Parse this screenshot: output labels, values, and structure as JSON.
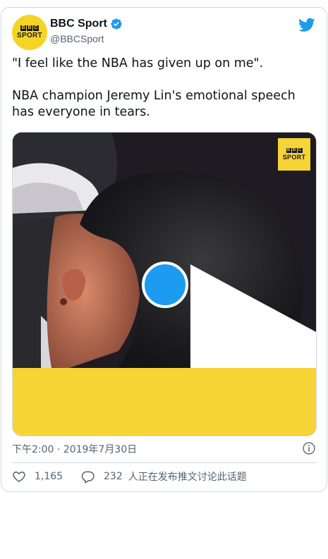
{
  "account": {
    "avatar_bbc_letters": [
      "B",
      "B",
      "C"
    ],
    "avatar_sport_text": "SPORT",
    "display_name": "BBC Sport",
    "handle": "@BBCSport",
    "verified_icon": "verified-badge-icon",
    "brand_icon": "twitter-bird-icon"
  },
  "tweet": {
    "paragraphs": [
      "\"I feel like the NBA has given up on me\".",
      "NBA champion Jeremy Lin's emotional speech has everyone in tears."
    ]
  },
  "media": {
    "type": "video",
    "logo_bbc_letters": [
      "B",
      "B",
      "C"
    ],
    "logo_sport_text": "SPORT",
    "play_icon": "play-icon"
  },
  "meta": {
    "timestamp": "下午2:00 · 2019年7月30日",
    "info_icon": "info-icon"
  },
  "actions": {
    "like_count": "1,165",
    "reply_count": "232",
    "reply_text": "人正在发布推文讨论此话题"
  },
  "colors": {
    "accent": "#1d9bf0",
    "brand_yellow": "#f6d436",
    "text_primary": "#0f1419",
    "text_secondary": "#536471",
    "border": "#cfd9de"
  }
}
